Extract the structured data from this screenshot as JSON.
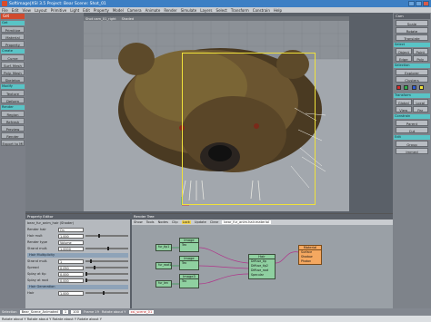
{
  "window": {
    "title": "Softimage|XSI 3.5 Project: Bear    Scene: Shot_01",
    "app_icon_color": "#d94c2b"
  },
  "menubar": [
    "File",
    "Edit",
    "View",
    "Layout",
    "Primitive",
    "Light",
    "Edit",
    "Property",
    "Model",
    "Camera",
    "Animate",
    "Render",
    "Simulate",
    "Layers",
    "Select",
    "Transform",
    "Constrain",
    "Help"
  ],
  "left_toolbar": {
    "header": "Get",
    "groups": [
      {
        "label": "Get",
        "buttons": [
          "Primitive",
          "Material",
          "Property"
        ]
      },
      {
        "label": "Create",
        "buttons": [
          "Curve",
          "Surf. Mesh",
          "Poly. Mesh",
          "Skeleton"
        ]
      },
      {
        "label": "Modify",
        "buttons": [
          "Texture",
          "Deform"
        ]
      },
      {
        "label": "Render",
        "buttons": [
          "Region",
          "Refresh",
          "Preview",
          "Render",
          "Export to MI"
        ]
      }
    ]
  },
  "viewport": {
    "label": "Shot cam_01_right",
    "mode": "Shaded",
    "background_color": "#999ea4",
    "selection_color": "#f0e23a"
  },
  "right_panel": {
    "header": "Cam",
    "buttons_top": [
      "Scale",
      "Rotate",
      "Translate"
    ],
    "buttons_mid": [
      "Object",
      "Point",
      "Edge",
      "Poly"
    ],
    "select_label": "Select",
    "groups": [
      {
        "label": "Selection",
        "buttons": [
          "Explorer",
          "Clusters"
        ]
      },
      {
        "label": "Transform",
        "buttons": [
          "Global",
          "Local",
          "View",
          "Par"
        ]
      },
      {
        "label": "Constrain",
        "buttons": [
          "Parent",
          "Cut"
        ]
      },
      {
        "label": "Edit",
        "buttons": [
          "Group",
          "Immed"
        ]
      }
    ],
    "swatches": [
      "#d42c2c",
      "#2cb04a",
      "#2c5ad4",
      "#f0e23a"
    ]
  },
  "property_editor": {
    "title": "Property Editor",
    "subtitle": "bear_fur_anim_hair (Shader)",
    "rows": [
      {
        "label": "Render hair",
        "value": "On"
      },
      {
        "label": "Hair mult",
        "value": "1.000"
      },
      {
        "label": "Render type",
        "value": "Volume"
      },
      {
        "label": "Strand mult.",
        "value": "1.0000"
      }
    ],
    "section_label": "Hair Multiplicity",
    "sub_rows": [
      {
        "label": "Strand mult.",
        "value": "1"
      },
      {
        "label": "Spread",
        "value": "0.050"
      },
      {
        "label": "Splay at tip",
        "value": "0.000"
      },
      {
        "label": "Splay at root",
        "value": "0.000"
      }
    ],
    "section2_label": "Hair Generation",
    "bottom_row": {
      "label": "Hair",
      "value": "1.000"
    }
  },
  "render_tree": {
    "title": "Render Tree",
    "menu": [
      "Show",
      "Tools",
      "Nodes",
      "Clip",
      "Lock",
      "Update",
      "Clear"
    ],
    "lock_label": "Lock",
    "breadcrumb": "bear_fur_anim.hair.material",
    "nodes": {
      "image1": {
        "title": "Image",
        "ports": [
          "Tex"
        ]
      },
      "image2": {
        "title": "Image",
        "ports": [
          "Tex"
        ]
      },
      "image3": {
        "title": "Image3",
        "ports": [
          "Tex"
        ]
      },
      "src1": {
        "label": "fur_tip1"
      },
      "src2": {
        "label": "fur_root1"
      },
      "src3": {
        "label": "fur_len"
      },
      "hair": {
        "title": "Hair",
        "ports": [
          "Diffuse_tip",
          "Diffuse_tip2",
          "Diffuse_root",
          "Specular"
        ]
      },
      "material": {
        "title": "Material",
        "ports": [
          "Surface",
          "Shadow",
          "Photon"
        ]
      }
    }
  },
  "status": {
    "frame_label": "Selection",
    "scene_path": "Bear_Scene_Animated",
    "frame_start": "1",
    "frame_end": "100",
    "current_frame": "Frame 19",
    "command": "Rotate about Y",
    "command_line": "xsi_scene_01",
    "help_text": "Rotate about Y    Rotate about Y    Rotate about Y    Rotate about Y"
  }
}
